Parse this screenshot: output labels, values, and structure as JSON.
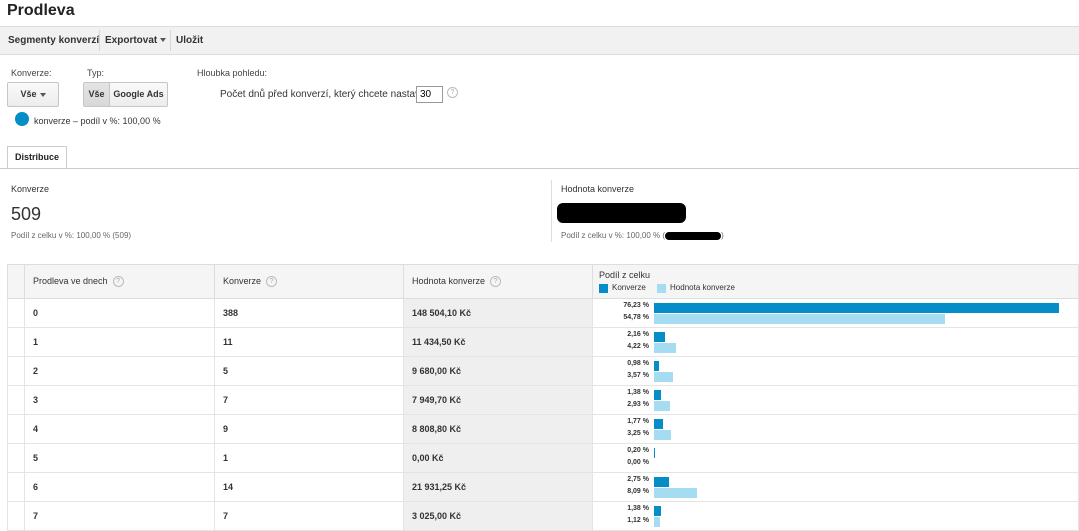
{
  "page": {
    "title": "Prodleva"
  },
  "toolbar": {
    "segments": "Segmenty konverzí",
    "export": "Exportovat",
    "save": "Uložit"
  },
  "filters": {
    "conversion_label": "Konverze:",
    "conversion_value": "Vše",
    "type_label": "Typ:",
    "type_all": "Vše",
    "type_ads": "Google Ads",
    "depth_label": "Hloubka pohledu:",
    "depth_text": "Počet dnů před konverzí, který chcete nastavit:",
    "depth_value": "30",
    "legend_text": "konverze – podíl v %: 100,00 %"
  },
  "tabs": {
    "distribution": "Distribuce"
  },
  "summary": {
    "conversions_label": "Konverze",
    "conversions_value": "509",
    "conversions_sub": "Podíl z celku v %: 100,00 % (509)",
    "value_label": "Hodnota konverze",
    "value_sub_prefix": "Podíl z celku v %: 100,00 % (",
    "value_sub_suffix": ")"
  },
  "table": {
    "headers": {
      "delay": "Prodleva ve dnech",
      "conversions": "Konverze",
      "value": "Hodnota konverze",
      "share": "Podíl z celku",
      "legend_conv": "Konverze",
      "legend_value": "Hodnota konverze"
    },
    "rows": [
      {
        "delay": "0",
        "conversions": "388",
        "value": "148 504,10 Kč",
        "pct_conv": "76,23 %",
        "pct_value": "54,78 %",
        "conv_share": 76.23,
        "value_share": 54.78
      },
      {
        "delay": "1",
        "conversions": "11",
        "value": "11 434,50 Kč",
        "pct_conv": "2,16 %",
        "pct_value": "4,22 %",
        "conv_share": 2.16,
        "value_share": 4.22
      },
      {
        "delay": "2",
        "conversions": "5",
        "value": "9 680,00 Kč",
        "pct_conv": "0,98 %",
        "pct_value": "3,57 %",
        "conv_share": 0.98,
        "value_share": 3.57
      },
      {
        "delay": "3",
        "conversions": "7",
        "value": "7 949,70 Kč",
        "pct_conv": "1,38 %",
        "pct_value": "2,93 %",
        "conv_share": 1.38,
        "value_share": 2.93
      },
      {
        "delay": "4",
        "conversions": "9",
        "value": "8 808,80 Kč",
        "pct_conv": "1,77 %",
        "pct_value": "3,25 %",
        "conv_share": 1.77,
        "value_share": 3.25
      },
      {
        "delay": "5",
        "conversions": "1",
        "value": "0,00 Kč",
        "pct_conv": "0,20 %",
        "pct_value": "0,00 %",
        "conv_share": 0.2,
        "value_share": 0.0
      },
      {
        "delay": "6",
        "conversions": "14",
        "value": "21 931,25 Kč",
        "pct_conv": "2,75 %",
        "pct_value": "8,09 %",
        "conv_share": 2.75,
        "value_share": 8.09
      },
      {
        "delay": "7",
        "conversions": "7",
        "value": "3 025,00 Kč",
        "pct_conv": "1,38 %",
        "pct_value": "1,12 %",
        "conv_share": 1.38,
        "value_share": 1.12
      }
    ]
  },
  "colors": {
    "conv_bar": "#058dc7",
    "value_bar": "#a6dcf2"
  },
  "icons": {
    "help": "question-mark-icon",
    "caret": "caret-down-icon",
    "legend_dot": "circle-icon"
  }
}
